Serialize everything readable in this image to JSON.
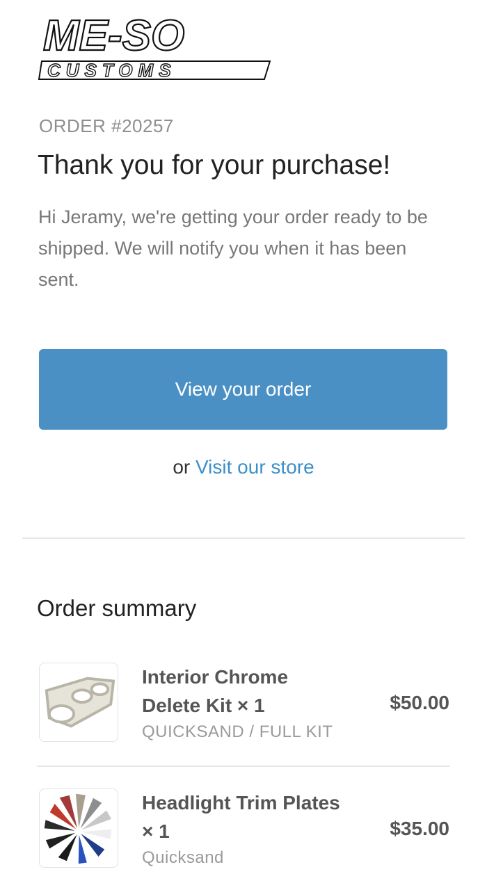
{
  "brand": {
    "logo_line1": "ME-SO",
    "logo_line2": "CUSTOMS"
  },
  "order": {
    "number_label": "ORDER #20257",
    "headline": "Thank you for your purchase!",
    "intro": "Hi Jeramy, we're getting your order ready to be shipped. We will notify you when it has been sent."
  },
  "actions": {
    "view_order_label": "View your order",
    "or_text": "or",
    "visit_store_label": "Visit our store",
    "button_color": "#4a90c4",
    "link_color": "#3d8fc8"
  },
  "summary": {
    "title": "Order summary",
    "items": [
      {
        "name": "Interior Chrome Delete Kit × 1",
        "variant": "QUICKSAND / FULL KIT",
        "price": "$50.00"
      },
      {
        "name": "Headlight Trim Plates × 1",
        "variant": "Quicksand",
        "price": "$35.00"
      }
    ]
  }
}
